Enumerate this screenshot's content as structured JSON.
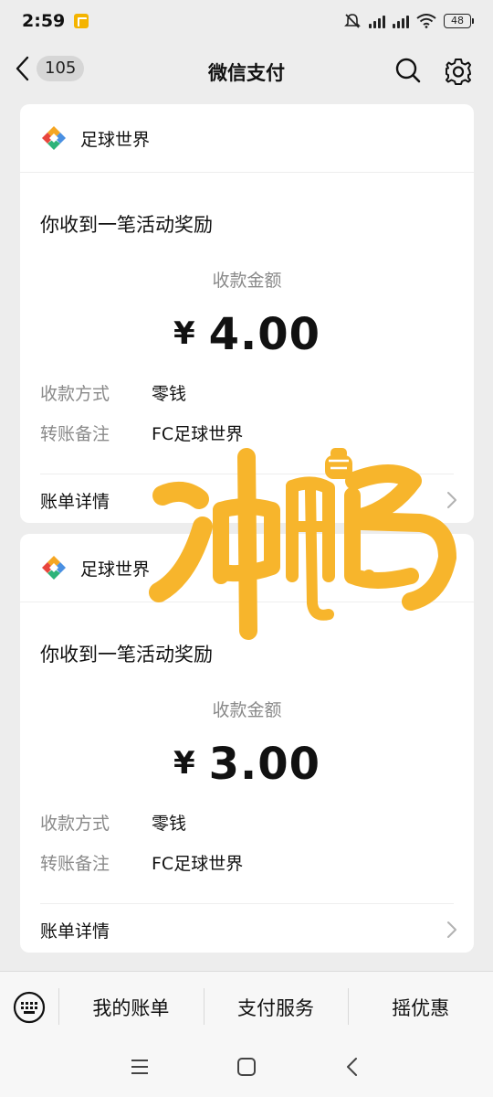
{
  "status_bar": {
    "time": "2:59",
    "battery": "48"
  },
  "nav": {
    "back_count": "105",
    "title": "微信支付"
  },
  "cards": [
    {
      "merchant": "足球世界",
      "heading": "你收到一笔活动奖励",
      "amount_label": "收款金额",
      "currency": "¥",
      "amount": "4.00",
      "method_label": "收款方式",
      "method_value": "零钱",
      "note_label": "转账备注",
      "note_value": "FC足球世界",
      "bill_link": "账单详情"
    },
    {
      "merchant": "足球世界",
      "heading": "你收到一笔活动奖励",
      "amount_label": "收款金额",
      "currency": "¥",
      "amount": "3.00",
      "method_label": "收款方式",
      "method_value": "零钱",
      "note_label": "转账备注",
      "note_value": "FC足球世界",
      "bill_link": "账单详情"
    }
  ],
  "bottom_menu": {
    "items": [
      "我的账单",
      "支付服务",
      "摇优惠"
    ]
  },
  "watermark": {
    "text": "冲鸭"
  },
  "colors": {
    "background": "#ededed",
    "card": "#ffffff",
    "watermark": "#f7b52c"
  }
}
